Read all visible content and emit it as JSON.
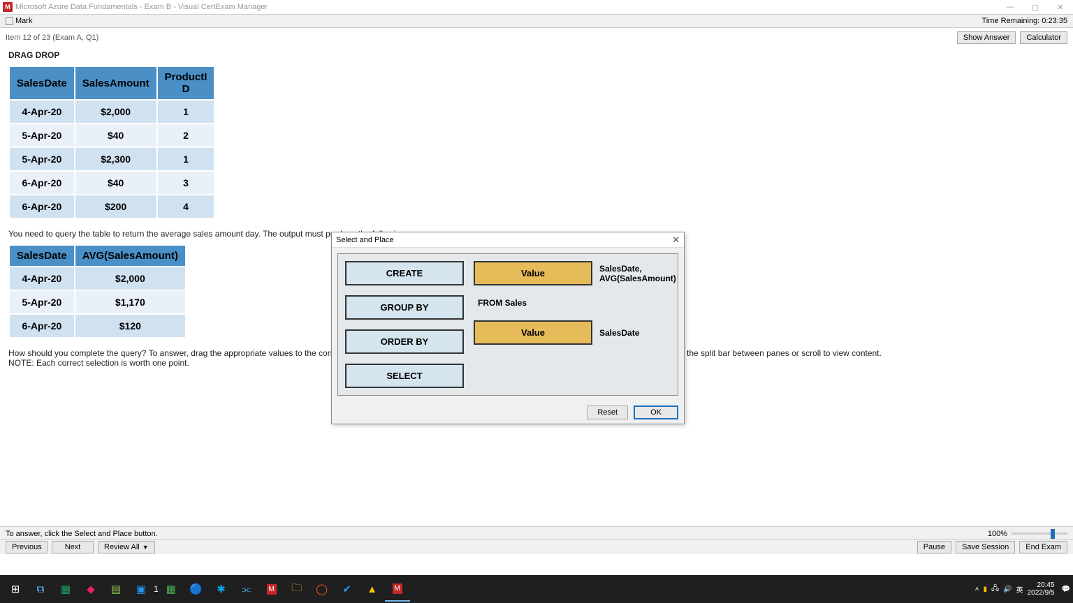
{
  "window": {
    "title": "Microsoft Azure Data Fundamentals - Exam B - Visual CertExam Manager",
    "app_icon_letter": "M"
  },
  "toolbar1": {
    "mark_label": "Mark",
    "time_remaining_label": "Time Remaining: 0:23:35"
  },
  "toolbar2": {
    "item_label": "Item 12 of 23  (Exam A, Q1)",
    "show_answer": "Show Answer",
    "calculator": "Calculator"
  },
  "content": {
    "drag_drop_label": "DRAG DROP",
    "table1_headers": [
      "SalesDate",
      "SalesAmount",
      "ProductID"
    ],
    "table1_rows": [
      [
        "4-Apr-20",
        "$2,000",
        "1"
      ],
      [
        "5-Apr-20",
        "$40",
        "2"
      ],
      [
        "5-Apr-20",
        "$2,300",
        "1"
      ],
      [
        "6-Apr-20",
        "$40",
        "3"
      ],
      [
        "6-Apr-20",
        "$200",
        "4"
      ]
    ],
    "question_line1": "You need to query the table to return the average sales amount day. The output must produce the following",
    "table2_headers": [
      "SalesDate",
      "AVG(SalesAmount)"
    ],
    "table2_rows": [
      [
        "4-Apr-20",
        "$2,000"
      ],
      [
        "5-Apr-20",
        "$1,170"
      ],
      [
        "6-Apr-20",
        "$120"
      ]
    ],
    "question_line2": "How should you complete the query? To answer, drag the appropriate values to the correct targets. Each value may be used once, more than once, or not at all. You may need to drag the split bar between panes or scroll to view content.",
    "question_note": "NOTE: Each correct selection is worth one point.",
    "select_place_button": "Select and Place"
  },
  "modal": {
    "title": "Select and Place",
    "drag_items": [
      "CREATE",
      "GROUP BY",
      "ORDER BY",
      "SELECT"
    ],
    "drop_label": "Value",
    "right_label1": "SalesDate,\nAVG(SalesAmount)",
    "from_sales": "FROM Sales",
    "right_label2": "SalesDate",
    "reset": "Reset",
    "ok": "OK"
  },
  "footer": {
    "hint": "To answer, click the Select and Place button.",
    "zoom": "100%",
    "previous": "Previous",
    "next": "Next",
    "review_all": "Review All",
    "pause": "Pause",
    "save_session": "Save Session",
    "end_exam": "End Exam"
  },
  "taskbar": {
    "ime": "英",
    "time": "20:45",
    "date": "2022/9/5"
  }
}
